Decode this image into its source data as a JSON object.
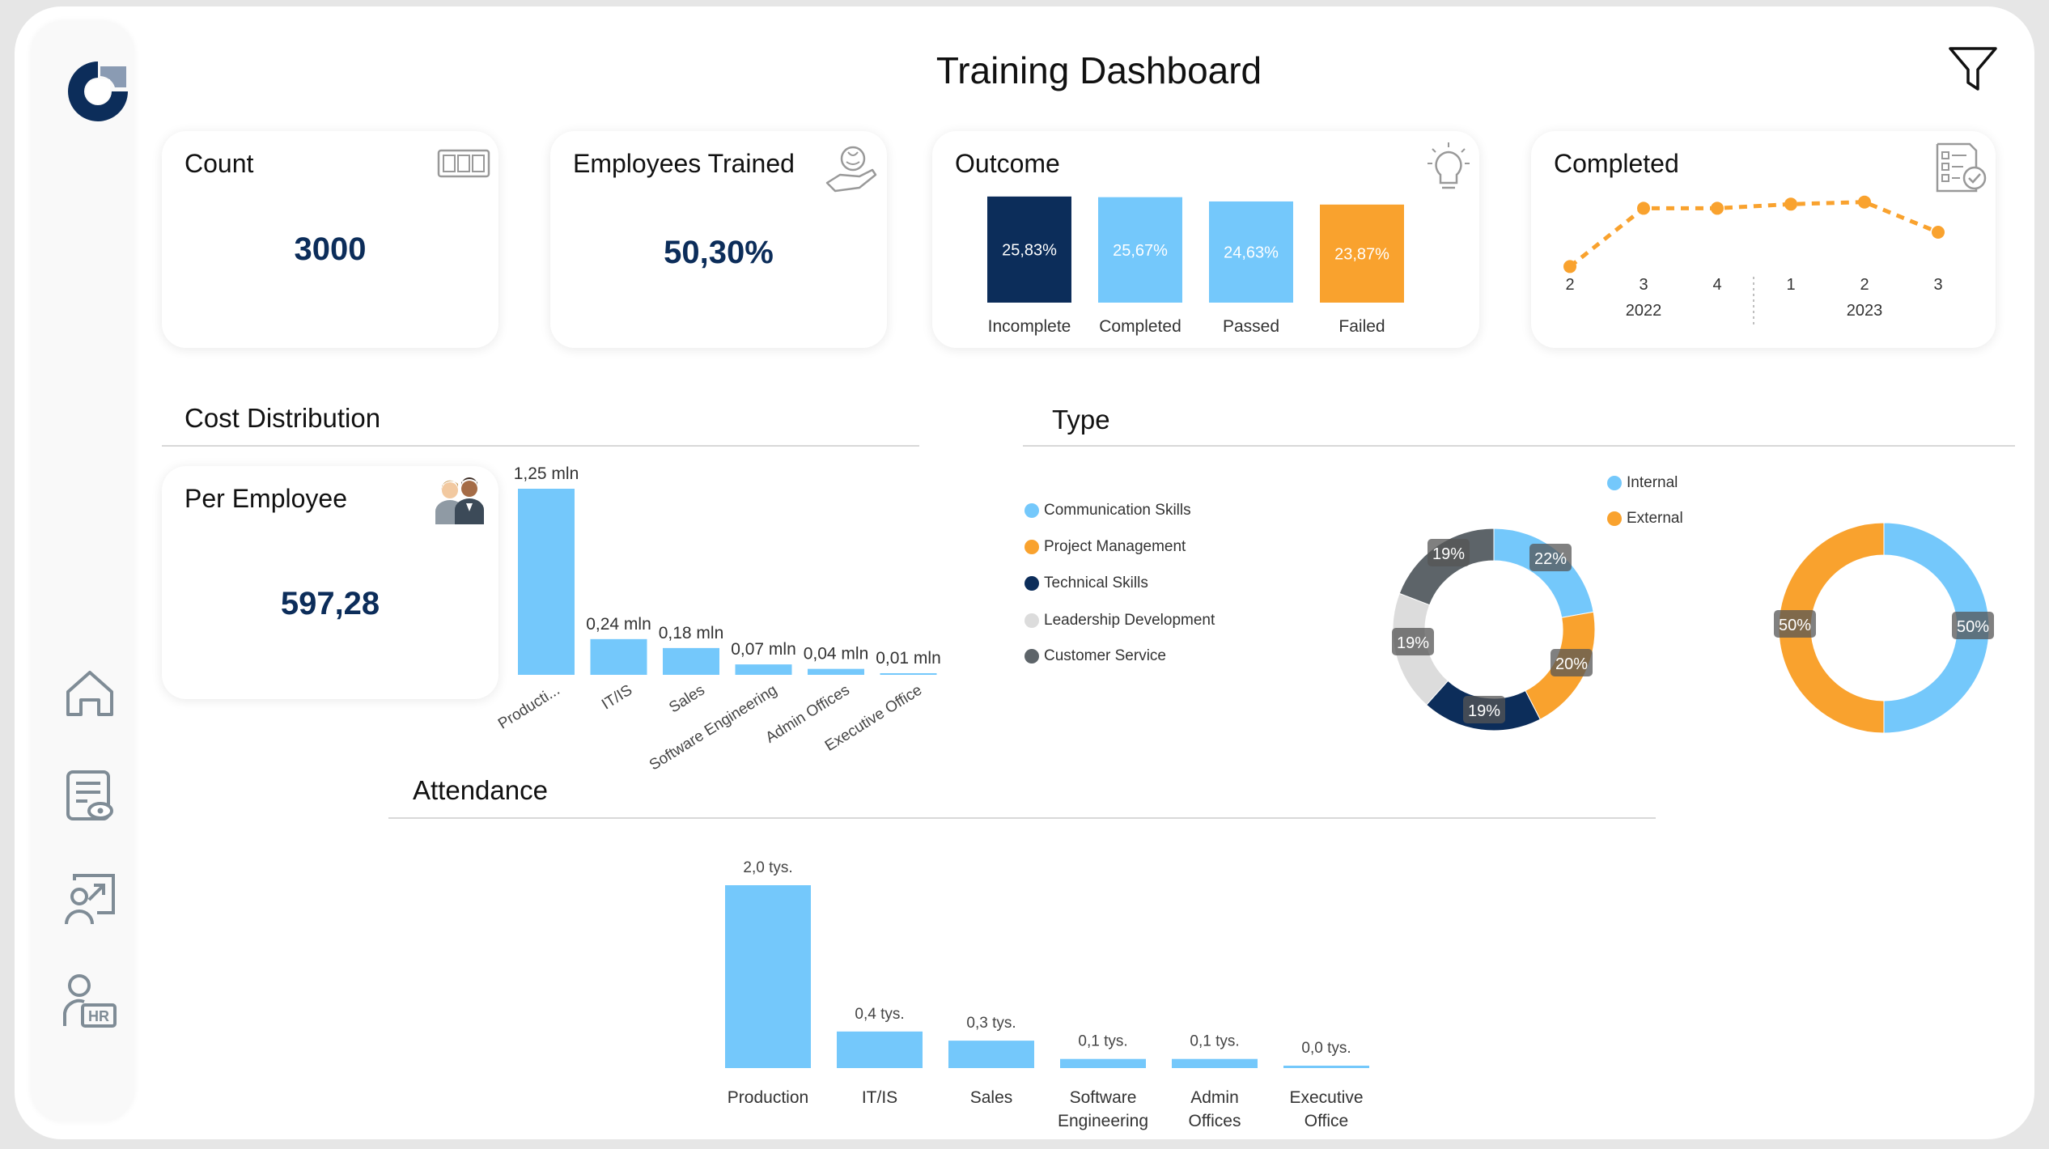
{
  "header": {
    "title": "Training Dashboard"
  },
  "colors": {
    "navy": "#0c2d5a",
    "blue": "#74c8fb",
    "orange": "#f9a22e",
    "light_gray": "#dcdcdc",
    "dark_gray": "#5d6469"
  },
  "icons": {
    "logo": "company-logo",
    "filter": "filter-icon",
    "nav": [
      "home-icon",
      "report-icon",
      "user-growth-icon",
      "hr-icon"
    ]
  },
  "kpis": {
    "count": {
      "label": "Count",
      "value": "3000",
      "icon": "counter-icon"
    },
    "trained": {
      "label": "Employees Trained",
      "value": "50,30%",
      "icon": "brain-hand-icon"
    },
    "per_employee": {
      "label": "Per Employee",
      "value": "597,28",
      "icon": "people-icon"
    }
  },
  "outcome": {
    "label": "Outcome",
    "icon": "lightbulb-icon",
    "chart_data": {
      "type": "bar",
      "categories": [
        "Incomplete",
        "Completed",
        "Passed",
        "Failed"
      ],
      "values": [
        25.83,
        25.67,
        24.63,
        23.87
      ],
      "data_labels": [
        "25,83%",
        "25,67%",
        "24,63%",
        "23,87%"
      ],
      "colors": [
        "#0c2d5a",
        "#74c8fb",
        "#74c8fb",
        "#f9a22e"
      ]
    }
  },
  "completed": {
    "label": "Completed",
    "icon": "checklist-icon",
    "chart_data": {
      "type": "line",
      "x": [
        "2",
        "3",
        "4",
        "1",
        "2",
        "3"
      ],
      "x_groups": [
        {
          "label": "2022",
          "from": 0,
          "to": 2
        },
        {
          "label": "2023",
          "from": 3,
          "to": 5
        }
      ],
      "values": [
        62,
        90,
        118,
        118,
        122,
        124,
        95
      ],
      "style": "dotted",
      "color": "#f9a22e"
    }
  },
  "cost": {
    "section_title": "Cost Distribution",
    "chart_data": {
      "type": "bar",
      "categories": [
        "Producti...",
        "IT/IS",
        "Sales",
        "Software Engineering",
        "Admin Offices",
        "Executive Office"
      ],
      "values": [
        1.25,
        0.24,
        0.18,
        0.07,
        0.04,
        0.01
      ],
      "data_labels": [
        "1,25 mln",
        "0,24 mln",
        "0,18 mln",
        "0,07 mln",
        "0,04 mln",
        "0,01 mln"
      ],
      "color": "#74c8fb"
    }
  },
  "type": {
    "section_title": "Type",
    "chart_data": [
      {
        "type": "pie",
        "categories": [
          "Communication Skills",
          "Project Management",
          "Technical Skills",
          "Leadership Development",
          "Customer Service"
        ],
        "values": [
          22,
          20,
          19,
          19,
          19
        ],
        "data_labels": [
          "22%",
          "20%",
          "19%",
          "19%",
          "19%"
        ],
        "colors": [
          "#74c8fb",
          "#f9a22e",
          "#0c2d5a",
          "#dcdcdc",
          "#5d6469"
        ],
        "legend": "left"
      },
      {
        "type": "pie",
        "categories": [
          "Internal",
          "External"
        ],
        "values": [
          50,
          50
        ],
        "data_labels": [
          "50%",
          "50%"
        ],
        "colors": [
          "#74c8fb",
          "#f9a22e"
        ],
        "legend": "top-left"
      }
    ]
  },
  "attendance": {
    "section_title": "Attendance",
    "chart_data": {
      "type": "bar",
      "categories": [
        "Production",
        "IT/IS",
        "Sales",
        "Software Engineering",
        "Admin Offices",
        "Executive Office"
      ],
      "category_lines": [
        [
          "Production"
        ],
        [
          "IT/IS"
        ],
        [
          "Sales"
        ],
        [
          "Software",
          "Engineering"
        ],
        [
          "Admin",
          "Offices"
        ],
        [
          "Executive",
          "Office"
        ]
      ],
      "values": [
        2.0,
        0.4,
        0.3,
        0.1,
        0.1,
        0.0
      ],
      "data_labels": [
        "2,0 tys.",
        "0,4 tys.",
        "0,3 tys.",
        "0,1 tys.",
        "0,1 tys.",
        "0,0 tys."
      ],
      "color": "#74c8fb"
    }
  }
}
